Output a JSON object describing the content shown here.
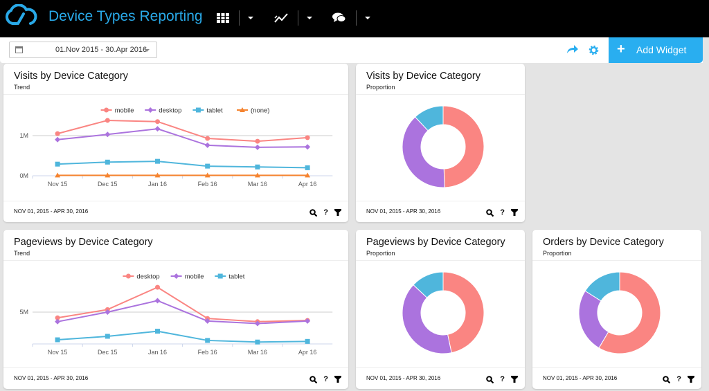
{
  "header": {
    "title": "Device Types Reporting",
    "icons": [
      "cloud-logo",
      "grid-icon",
      "trend-icon",
      "chat-icon"
    ]
  },
  "toolbar": {
    "date_range": "01.Nov 2015 - 30.Apr 2016",
    "add_widget": "Add Widget"
  },
  "colors": {
    "red": "#fa8582",
    "purple": "#ab73de",
    "blue": "#4fb6dc",
    "orange": "#f58430",
    "accent": "#29aef0"
  },
  "widgets": [
    {
      "title": "Visits by Device Category",
      "subtitle": "Trend",
      "footer": "NOV 01, 2015 - APR 30, 2016"
    },
    {
      "title": "Visits by Device Category",
      "subtitle": "Proportion",
      "footer": "NOV 01, 2015 - APR 30, 2016"
    },
    {
      "title": "Pageviews by Device Category",
      "subtitle": "Trend",
      "footer": "NOV 01, 2015 - APR 30, 2016"
    },
    {
      "title": "Pageviews by Device Category",
      "subtitle": "Proportion",
      "footer": "NOV 01, 2015 - APR 30, 2016"
    },
    {
      "title": "Orders by Device Category",
      "subtitle": "Proportion",
      "footer": "NOV 01, 2015 - APR 30, 2016"
    }
  ],
  "chart_data": [
    {
      "type": "line",
      "categories": [
        "Nov 15",
        "Dec 15",
        "Jan 16",
        "Feb 16",
        "Mar 16",
        "Apr 16"
      ],
      "yticks": [
        "0M",
        "1M"
      ],
      "ylim": [
        0,
        1.6
      ],
      "grid": true,
      "legend": "top",
      "series": [
        {
          "name": "mobile",
          "color": "#fa8582",
          "marker": "circle",
          "values": [
            1.05,
            1.38,
            1.35,
            0.93,
            0.86,
            0.95
          ]
        },
        {
          "name": "desktop",
          "color": "#ab73de",
          "marker": "diamond",
          "values": [
            0.9,
            1.03,
            1.17,
            0.76,
            0.71,
            0.72
          ]
        },
        {
          "name": "tablet",
          "color": "#4fb6dc",
          "marker": "square",
          "values": [
            0.29,
            0.34,
            0.36,
            0.24,
            0.22,
            0.2
          ]
        },
        {
          "name": "(none)",
          "color": "#f58430",
          "marker": "triangle",
          "values": [
            0.01,
            0.01,
            0.01,
            0.01,
            0.01,
            0.01
          ]
        }
      ]
    },
    {
      "type": "pie",
      "donut": true,
      "slices": [
        {
          "color": "#fa8582",
          "value": 49.4
        },
        {
          "color": "#ab73de",
          "value": 38.6
        },
        {
          "color": "#4fb6dc",
          "value": 12
        }
      ]
    },
    {
      "type": "line",
      "categories": [
        "Nov 15",
        "Dec 15",
        "Jan 16",
        "Feb 16",
        "Mar 16",
        "Apr 16"
      ],
      "yticks": [
        "5M"
      ],
      "ylim": [
        0,
        10
      ],
      "grid": true,
      "legend": "top",
      "series": [
        {
          "name": "desktop",
          "color": "#fa8582",
          "marker": "circle",
          "values": [
            4.1,
            5.4,
            8.9,
            4.0,
            3.5,
            3.7
          ]
        },
        {
          "name": "mobile",
          "color": "#ab73de",
          "marker": "diamond",
          "values": [
            3.5,
            5.0,
            6.8,
            3.6,
            3.2,
            3.6
          ]
        },
        {
          "name": "tablet",
          "color": "#4fb6dc",
          "marker": "square",
          "values": [
            0.65,
            1.2,
            2.0,
            0.55,
            0.3,
            0.4
          ]
        }
      ]
    },
    {
      "type": "pie",
      "donut": true,
      "slices": [
        {
          "color": "#fa8582",
          "value": 46.7
        },
        {
          "color": "#ab73de",
          "value": 40.3
        },
        {
          "color": "#4fb6dc",
          "value": 13
        }
      ]
    },
    {
      "type": "pie",
      "donut": true,
      "slices": [
        {
          "color": "#fa8582",
          "value": 58.5
        },
        {
          "color": "#ab73de",
          "value": 25.5
        },
        {
          "color": "#4fb6dc",
          "value": 16
        }
      ]
    }
  ]
}
